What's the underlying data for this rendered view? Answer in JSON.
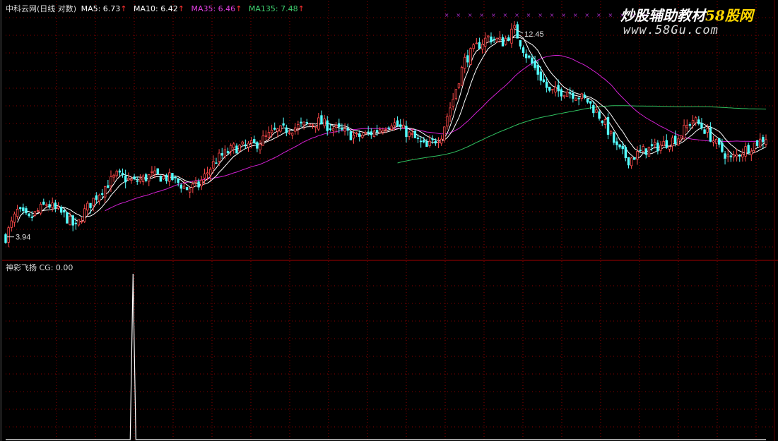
{
  "header": {
    "stock_label": "中科云网(日线 对数)",
    "ma5": "MA5: 6.73",
    "ma10": "MA10: 6.42",
    "ma35": "MA35: 6.46",
    "ma135": "MA135: 7.48",
    "up_arrow": "↑"
  },
  "indicator_header": "神彩飞扬  CG: 0.00",
  "watermark": {
    "cn_part": "炒股辅助教材",
    "brand_part": "58股网",
    "url": "www.58Gu.com"
  },
  "colors": {
    "background": "#000000",
    "grid": "#8b0000",
    "separator": "#a00000",
    "up_candle": "#ff4a4a",
    "down_candle": "#54ffff",
    "ma5": "#ffffff",
    "ma10": "#ffffff",
    "ma35": "#d020d0",
    "ma135": "#30c060",
    "watermark_cn": "#ffffff",
    "watermark_brand": "#ffd700",
    "watermark_url": "#dddddd",
    "indicator_line": "#ffffff",
    "header_text": "#dcdcdc",
    "ma5_text": "#ffffff",
    "ma35_text": "#e040e0",
    "ma135_text": "#40d070",
    "arrow": "#ff3030"
  },
  "chart_data": [
    {
      "type": "candlestick",
      "title": "中科云网(日线 对数)",
      "scale": "log",
      "annotations": [
        {
          "label": "12.45",
          "kind": "high"
        },
        {
          "label": "3.94",
          "kind": "low"
        }
      ],
      "ylim": [
        3.7,
        13.4
      ],
      "high": 12.45,
      "low": 3.94,
      "price_path": [
        [
          0,
          4.0
        ],
        [
          4,
          4.6
        ],
        [
          8,
          4.4
        ],
        [
          14,
          4.8
        ],
        [
          20,
          4.5
        ],
        [
          24,
          4.2
        ],
        [
          27,
          4.6
        ],
        [
          32,
          5.1
        ],
        [
          38,
          5.6
        ],
        [
          44,
          5.4
        ],
        [
          50,
          5.6
        ],
        [
          57,
          5.5
        ],
        [
          62,
          5.2
        ],
        [
          66,
          5.3
        ],
        [
          72,
          6.1
        ],
        [
          78,
          6.5
        ],
        [
          85,
          6.6
        ],
        [
          92,
          7.1
        ],
        [
          100,
          7.3
        ],
        [
          107,
          7.5
        ],
        [
          113,
          7.2
        ],
        [
          120,
          6.9
        ],
        [
          126,
          7.1
        ],
        [
          132,
          7.5
        ],
        [
          138,
          7.0
        ],
        [
          144,
          6.5
        ],
        [
          149,
          7.0
        ],
        [
          153,
          8.5
        ],
        [
          157,
          10.5
        ],
        [
          161,
          11.3
        ],
        [
          165,
          11.9
        ],
        [
          170,
          11.6
        ],
        [
          174,
          12.4
        ],
        [
          178,
          10.8
        ],
        [
          182,
          9.8
        ],
        [
          186,
          8.8
        ],
        [
          192,
          8.9
        ],
        [
          199,
          8.4
        ],
        [
          204,
          7.6
        ],
        [
          209,
          6.5
        ],
        [
          213,
          6.1
        ],
        [
          218,
          6.4
        ],
        [
          224,
          6.6
        ],
        [
          230,
          6.9
        ],
        [
          235,
          7.6
        ],
        [
          239,
          7.2
        ],
        [
          244,
          6.5
        ],
        [
          248,
          6.1
        ],
        [
          252,
          6.4
        ],
        [
          257,
          6.7
        ],
        [
          260,
          6.9
        ]
      ],
      "series": [
        {
          "name": "MA5",
          "value": 6.73
        },
        {
          "name": "MA10",
          "value": 6.42
        },
        {
          "name": "MA35",
          "value": 6.46
        },
        {
          "name": "MA135",
          "value": 7.48
        }
      ]
    },
    {
      "type": "line",
      "title": "神彩飞扬",
      "series": [
        {
          "name": "CG",
          "current": 0.0,
          "spikes": [
            {
              "position": 0.166,
              "value": 1
            }
          ]
        }
      ],
      "ylim": [
        0,
        1
      ]
    }
  ]
}
